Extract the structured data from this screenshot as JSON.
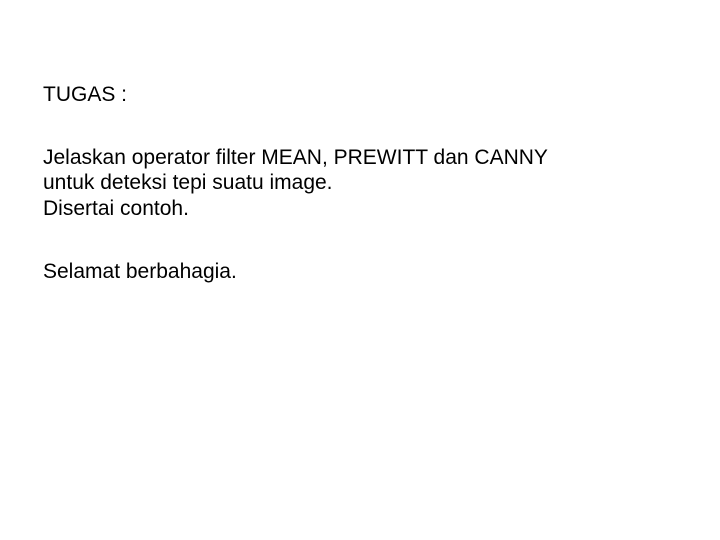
{
  "slide": {
    "heading": "TUGAS :",
    "body": {
      "line1": "Jelaskan operator filter  MEAN, PREWITT dan CANNY",
      "line2": "untuk deteksi tepi suatu image.",
      "line3": "Disertai contoh."
    },
    "closing": "Selamat berbahagia."
  }
}
